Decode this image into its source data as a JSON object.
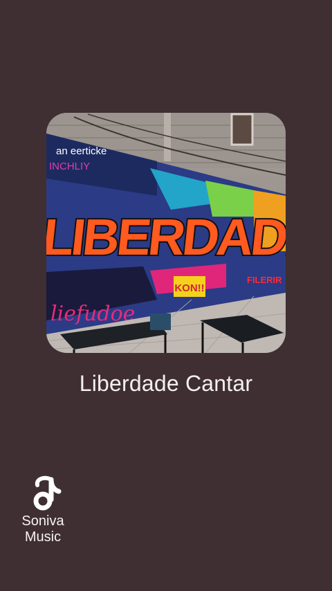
{
  "artwork": {
    "main_tag": "LIBERDADE",
    "small_tags": [
      "an eerticke",
      "INCHLIY",
      "liefudoe",
      "KON!!",
      "FILERIR"
    ],
    "alt": "Liberdade graffiti cover art"
  },
  "track": {
    "title": "Liberdade Cantar"
  },
  "brand": {
    "logo_icon": "soniva-note-icon",
    "name_line1": "Soniva",
    "name_line2": "Music"
  },
  "colors": {
    "background": "#3f2f33",
    "text": "#f4f0f1"
  }
}
